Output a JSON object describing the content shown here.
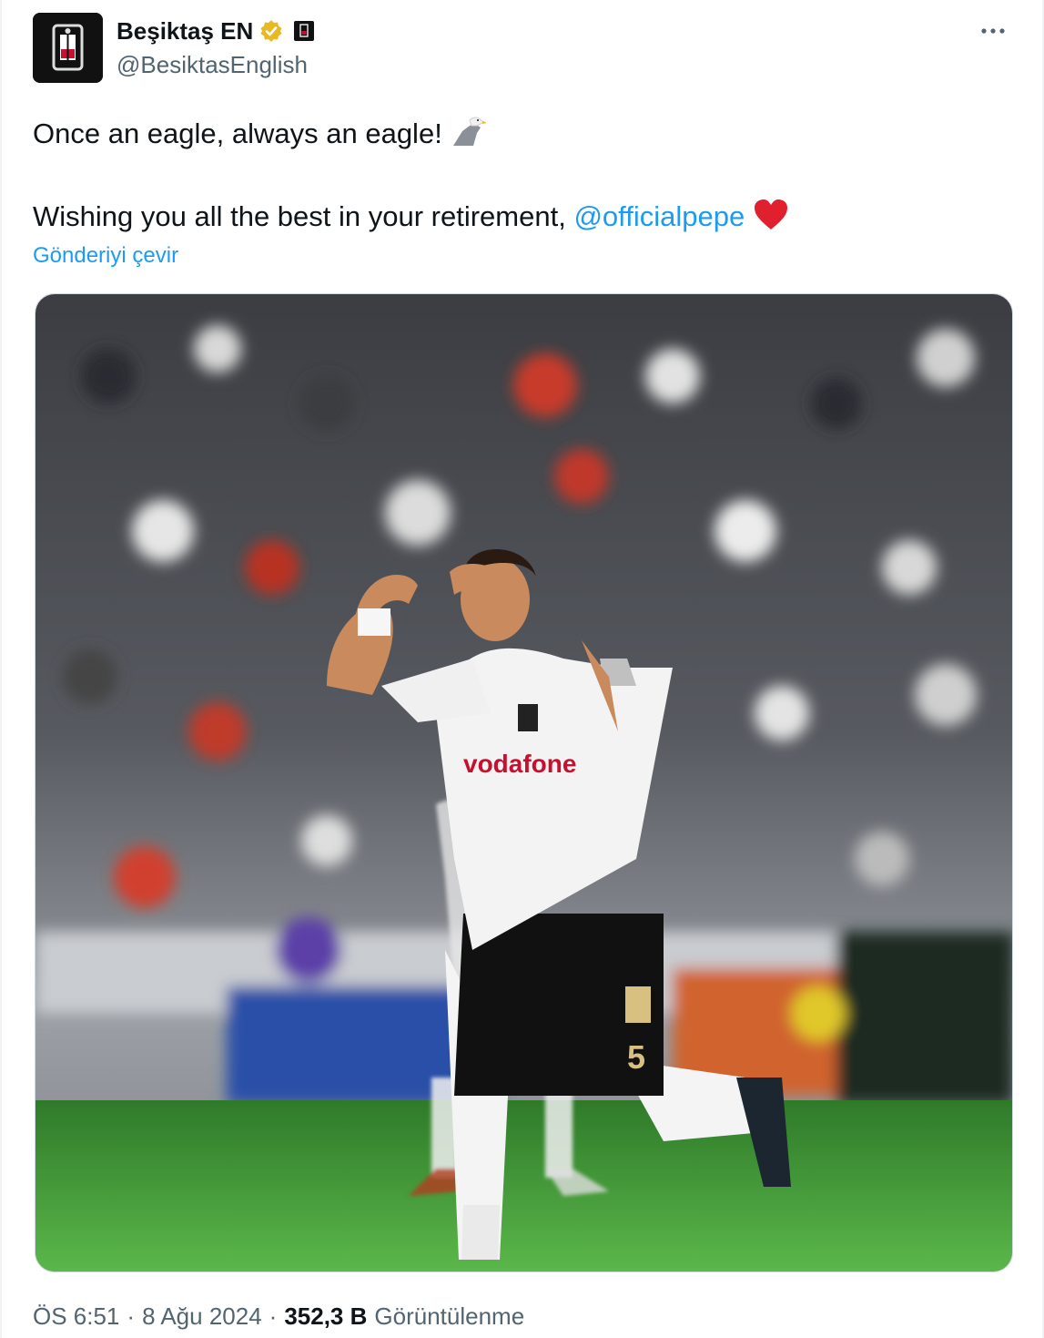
{
  "tweet": {
    "author": {
      "display_name": "Beşiktaş EN",
      "handle": "@BesiktasEnglish",
      "verified_color": "#e8b923"
    },
    "text_line1": "Once an eagle, always an eagle!",
    "text_line2_prefix": "Wishing you all the best in your retirement,",
    "mention": "@officialpepe",
    "translate_label": "Gönderiyi çevir",
    "time": "ÖS 6:51",
    "sep1": "·",
    "date": "8 Ağu 2024",
    "sep2": "·",
    "views_count": "352,3 B",
    "views_label": "Görüntülenme"
  },
  "colors": {
    "link": "#1d9bf0",
    "secondary_text": "#536471",
    "primary_text": "#0f1419"
  }
}
